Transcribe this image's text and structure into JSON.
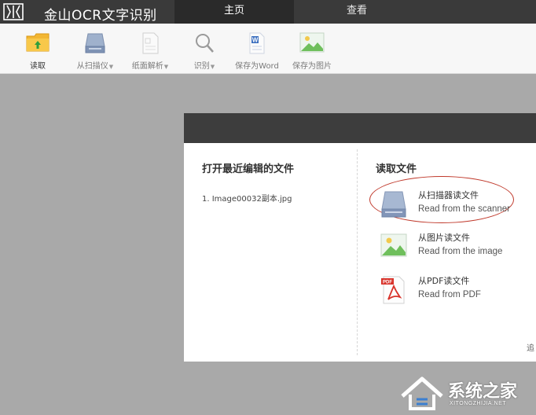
{
  "app": {
    "title": "金山OCR文字识别",
    "tabs": [
      {
        "label": "主页",
        "active": true
      },
      {
        "label": "查看",
        "active": false
      }
    ]
  },
  "toolbar": {
    "items": [
      {
        "label": "读取",
        "icon": "folder-icon",
        "dropdown": false
      },
      {
        "label": "从扫描仪",
        "icon": "scanner-icon",
        "dropdown": true
      },
      {
        "label": "纸面解析",
        "icon": "page-layout-icon",
        "dropdown": true
      },
      {
        "label": "识别",
        "icon": "magnifier-icon",
        "dropdown": true
      },
      {
        "label": "保存为Word",
        "icon": "word-document-icon",
        "dropdown": false
      },
      {
        "label": "保存为图片",
        "icon": "picture-icon",
        "dropdown": false
      }
    ],
    "caret": "▼"
  },
  "dialog": {
    "recent": {
      "title": "打开最近编辑的文件",
      "items": [
        "1.  Image00032副本.jpg"
      ]
    },
    "read": {
      "title": "读取文件",
      "options": [
        {
          "title": "从扫描器读文件",
          "subtitle": "Read from the scanner",
          "icon": "scanner-icon"
        },
        {
          "title": "从图片读文件",
          "subtitle": "Read from the image",
          "icon": "picture-icon"
        },
        {
          "title": "从PDF读文件",
          "subtitle": "Read from PDF",
          "icon": "pdf-icon"
        }
      ]
    },
    "edge_char": "追"
  },
  "watermark": {
    "text": "系统之家",
    "url": "XITONGZHIJIA.NET"
  },
  "colors": {
    "titlebar": "#3a3a3a",
    "accent_ring": "#c0392b",
    "background": "#a9a9a9"
  }
}
